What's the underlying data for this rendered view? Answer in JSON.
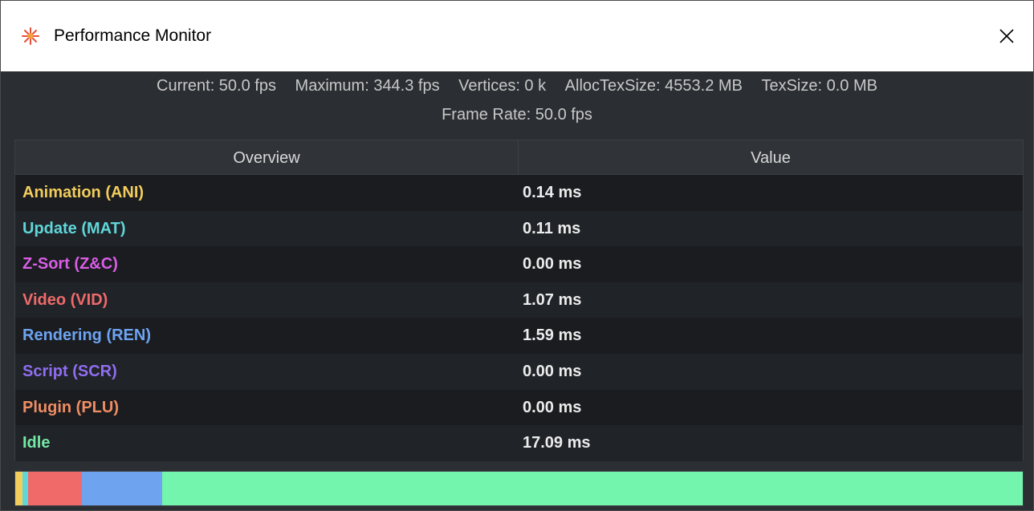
{
  "window": {
    "title": "Performance Monitor",
    "app_icon": "asterisk-sun-icon",
    "close_icon": "close-icon"
  },
  "stats": {
    "current": "Current: 50.0 fps",
    "maximum": "Maximum: 344.3 fps",
    "vertices": "Vertices: 0 k",
    "alloc_tex_size": "AllocTexSize: 4553.2 MB",
    "tex_size": "TexSize: 0.0 MB",
    "frame_rate": "Frame Rate: 50.0 fps"
  },
  "table": {
    "headers": {
      "overview": "Overview",
      "value": "Value"
    },
    "rows": [
      {
        "label": "Animation (ANI)",
        "value": "0.14 ms",
        "color": "#f2cd5c"
      },
      {
        "label": "Update (MAT)",
        "value": "0.11 ms",
        "color": "#5fd6d9"
      },
      {
        "label": "Z-Sort (Z&C)",
        "value": "0.00 ms",
        "color": "#d95ee6"
      },
      {
        "label": "Video (VID)",
        "value": "1.07 ms",
        "color": "#f06a6a"
      },
      {
        "label": "Rendering (REN)",
        "value": "1.59 ms",
        "color": "#6ea3f0"
      },
      {
        "label": "Script (SCR)",
        "value": "0.00 ms",
        "color": "#8f6ef0"
      },
      {
        "label": "Plugin (PLU)",
        "value": "0.00 ms",
        "color": "#ef8d63"
      },
      {
        "label": "Idle",
        "value": "17.09 ms",
        "color": "#74e8a4"
      }
    ]
  },
  "timeline_bar": {
    "segments": [
      {
        "name": "animation",
        "ms": 0.14,
        "color": "#f2cd5c"
      },
      {
        "name": "update",
        "ms": 0.11,
        "color": "#5fd6d9"
      },
      {
        "name": "zsort",
        "ms": 0.0,
        "color": "#d95ee6"
      },
      {
        "name": "video",
        "ms": 1.07,
        "color": "#f06a6a"
      },
      {
        "name": "rendering",
        "ms": 1.59,
        "color": "#6ea3f0"
      },
      {
        "name": "script",
        "ms": 0.0,
        "color": "#8f6ef0"
      },
      {
        "name": "plugin",
        "ms": 0.0,
        "color": "#ef8d63"
      },
      {
        "name": "idle",
        "ms": 17.09,
        "color": "#74f5ae"
      }
    ]
  }
}
